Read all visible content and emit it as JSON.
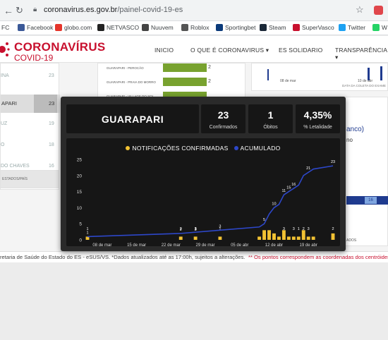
{
  "browser": {
    "url_host": "coronavirus.es.gov.br",
    "url_path": "/painel-covid-19-es",
    "bookmarks": [
      {
        "label": "FC",
        "icon": "folder-icon",
        "color": "#888888"
      },
      {
        "label": "Facebook",
        "icon": "facebook-icon",
        "color": "#3b5998"
      },
      {
        "label": "globo.com",
        "icon": "globo-icon",
        "color": "#e5352b"
      },
      {
        "label": "NETVASCO",
        "icon": "netvasco-icon",
        "color": "#222222"
      },
      {
        "label": "Nuuvem",
        "icon": "nuuvem-icon",
        "color": "#444444"
      },
      {
        "label": "Roblox",
        "icon": "roblox-icon",
        "color": "#555555"
      },
      {
        "label": "Sportingbet",
        "icon": "sportingbet-icon",
        "color": "#0b3a7a"
      },
      {
        "label": "Steam",
        "icon": "steam-icon",
        "color": "#1b2838"
      },
      {
        "label": "SuperVasco",
        "icon": "supervasco-icon",
        "color": "#c8102e"
      },
      {
        "label": "Twitter",
        "icon": "twitter-icon",
        "color": "#1da1f2"
      },
      {
        "label": "W",
        "icon": "whatsapp-icon",
        "color": "#25d366"
      }
    ]
  },
  "site": {
    "title": "CORONAVÍRUS",
    "subtitle": "COVID-19",
    "brand_color": "#c8102e",
    "nav": [
      "INICIO",
      "O QUE É CORONAVIRUS ▾",
      "ES SOLIDARIO",
      "TRANSPARÊNCIA ▾"
    ]
  },
  "background": {
    "left_rows": [
      {
        "name": "INA",
        "value": "23",
        "pct": "0,00%"
      },
      {
        "name": "APARI",
        "value": "23",
        "pct": ""
      },
      {
        "name": "UZ",
        "value": "19",
        "pct": ""
      },
      {
        "name": "O",
        "value": "18",
        "pct": ""
      },
      {
        "name": "DO CHAVES",
        "value": "16",
        "pct": ""
      }
    ],
    "left_footer": "ESTADOS/PAÍS",
    "bars": [
      {
        "label": "GUARAPARI - PEROCÃO",
        "value": "2"
      },
      {
        "label": "GUARAPARI - PRAIA DO MORRO",
        "value": "2"
      },
      {
        "label": "GUARAPARI - VILLAGE DO SOL",
        "value": "2"
      }
    ],
    "right_axis": [
      "08 de mar",
      "10 de abr"
    ],
    "right_axis_caption": "DATA DA COLETA DO EXAME",
    "right_text_1": "anco)",
    "right_text_2": "no",
    "right_badge": "16",
    "right_small": "ADOS"
  },
  "tooltip": {
    "municipality": "GUARAPARI",
    "confirmed": "23",
    "confirmed_label": "Confirmados",
    "deaths": "1",
    "deaths_label": "Óbitos",
    "lethality": "4,35%",
    "lethality_label": "% Letalidade"
  },
  "chart_data": {
    "type": "bar",
    "legend": [
      {
        "name": "NOTIFICAÇÕES CONFIRMADAS",
        "color": "#f2c233"
      },
      {
        "name": "ACUMULADO",
        "color": "#2d47c9"
      }
    ],
    "x_tick_labels": [
      "08 de mar",
      "15 de mar",
      "22 de mar",
      "29 de mar",
      "05 de abr",
      "12 de abr",
      "19 de abr"
    ],
    "xlim": [
      "2020-03-05",
      "2020-04-24"
    ],
    "ylim": [
      0,
      25
    ],
    "y_ticks": [
      0,
      5,
      10,
      15,
      20,
      25
    ],
    "series": [
      {
        "name": "NOTIFICAÇÕES CONFIRMADAS",
        "type": "bar",
        "x": [
          "2020-03-05",
          "2020-03-24",
          "2020-03-27",
          "2020-04-01",
          "2020-04-09",
          "2020-04-10",
          "2020-04-11",
          "2020-04-12",
          "2020-04-13",
          "2020-04-14",
          "2020-04-15",
          "2020-04-16",
          "2020-04-17",
          "2020-04-18",
          "2020-04-19",
          "2020-04-20",
          "2020-04-24"
        ],
        "y": [
          1,
          1,
          1,
          1,
          1,
          3,
          3,
          2,
          1,
          3,
          1,
          1,
          1,
          3,
          1,
          1,
          2
        ],
        "labels": [
          {
            "x": "2020-03-05",
            "text": "1"
          },
          {
            "x": "2020-03-24",
            "text": "2"
          },
          {
            "x": "2020-03-27",
            "text": "3"
          },
          {
            "x": "2020-03-27",
            "text": "1"
          },
          {
            "x": "2020-04-01",
            "text": "1"
          },
          {
            "x": "2020-04-14",
            "text": "3"
          },
          {
            "x": "2020-04-16",
            "text": "3"
          },
          {
            "x": "2020-04-17",
            "text": "1"
          },
          {
            "x": "2020-04-18",
            "text": "2"
          },
          {
            "x": "2020-04-19",
            "text": "3"
          },
          {
            "x": "2020-04-24",
            "text": "2"
          }
        ]
      },
      {
        "name": "ACUMULADO",
        "type": "line",
        "x": [
          "2020-03-05",
          "2020-03-24",
          "2020-04-01",
          "2020-04-09",
          "2020-04-10",
          "2020-04-11",
          "2020-04-12",
          "2020-04-13",
          "2020-04-14",
          "2020-04-15",
          "2020-04-16",
          "2020-04-17",
          "2020-04-18",
          "2020-04-19",
          "2020-04-20",
          "2020-04-24"
        ],
        "y": [
          1,
          2,
          3,
          4,
          5,
          8,
          10,
          11,
          14,
          15,
          16,
          17,
          20,
          21,
          22,
          23
        ],
        "labels": [
          {
            "x": "2020-03-05",
            "text": "1"
          },
          {
            "x": "2020-03-24",
            "text": "2"
          },
          {
            "x": "2020-03-27",
            "text": "3"
          },
          {
            "x": "2020-04-01",
            "text": "3"
          },
          {
            "x": "2020-04-10",
            "text": "5"
          },
          {
            "x": "2020-04-12",
            "text": "10"
          },
          {
            "x": "2020-04-14",
            "text": "11"
          },
          {
            "x": "2020-04-15",
            "text": "15"
          },
          {
            "x": "2020-04-16",
            "text": "16"
          },
          {
            "x": "2020-04-19",
            "text": "21"
          },
          {
            "x": "2020-04-24",
            "text": "23"
          }
        ]
      }
    ]
  },
  "footer": {
    "text": "retaria de Saúde do Estado do ES - eSUS/VS. *Dados atualizados até as 17:00h, sujeitos a alterações.",
    "note": "** Os pontos correspondem as coordenadas dos centróides"
  }
}
